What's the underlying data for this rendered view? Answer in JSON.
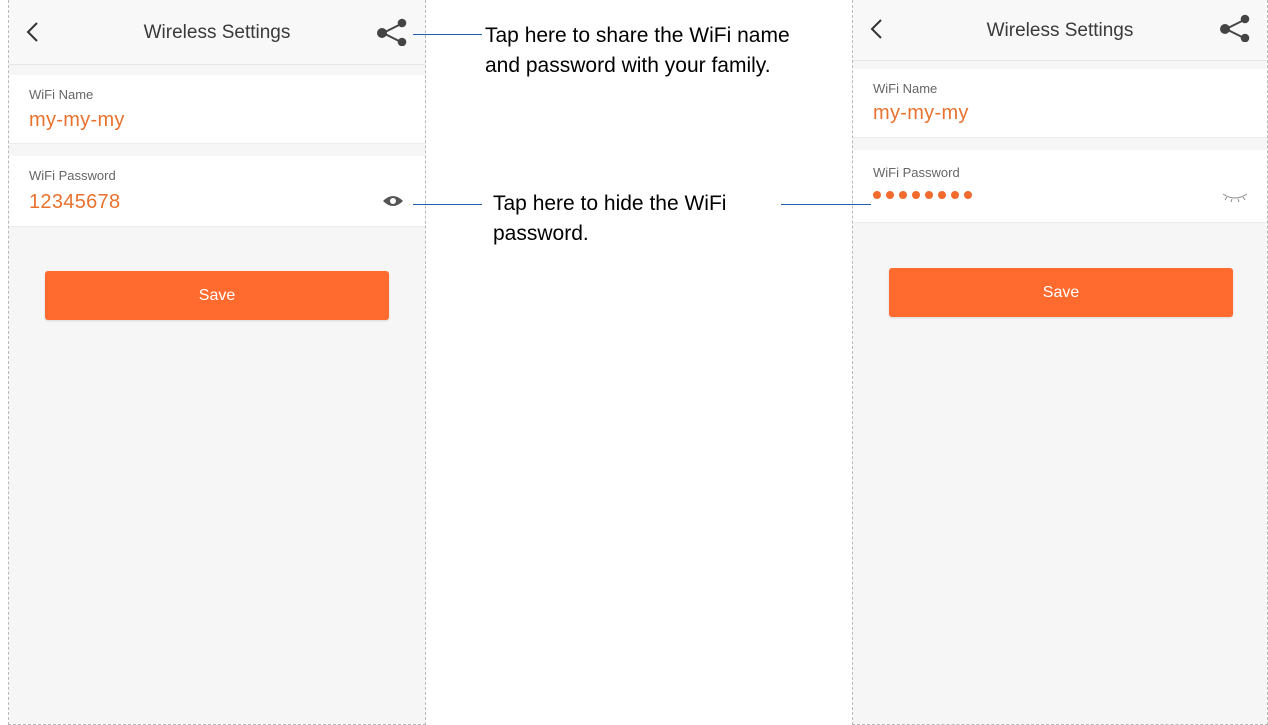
{
  "left_screen": {
    "nav": {
      "title": "Wireless Settings"
    },
    "wifi_name": {
      "label": "WiFi Name",
      "value": "my-my-my"
    },
    "wifi_password": {
      "label": "WiFi Password",
      "value": "12345678",
      "visible": true
    },
    "save_label": "Save"
  },
  "right_screen": {
    "nav": {
      "title": "Wireless Settings"
    },
    "wifi_name": {
      "label": "WiFi Name",
      "value": "my-my-my"
    },
    "wifi_password": {
      "label": "WiFi Password",
      "masked_dot_count": 8,
      "visible": false
    },
    "save_label": "Save"
  },
  "annotations": {
    "share": "Tap here to share the WiFi name and password with your family.",
    "hide_password": "Tap here to hide the WiFi password."
  },
  "icons": {
    "back": "chevron-left-icon",
    "share": "share-icon",
    "password_visible": "eye-icon",
    "password_hidden": "eye-closed-icon"
  },
  "colors": {
    "accent": "#ff6a2e",
    "value_text": "#e8722e",
    "callout_line": "#1f5fae"
  }
}
